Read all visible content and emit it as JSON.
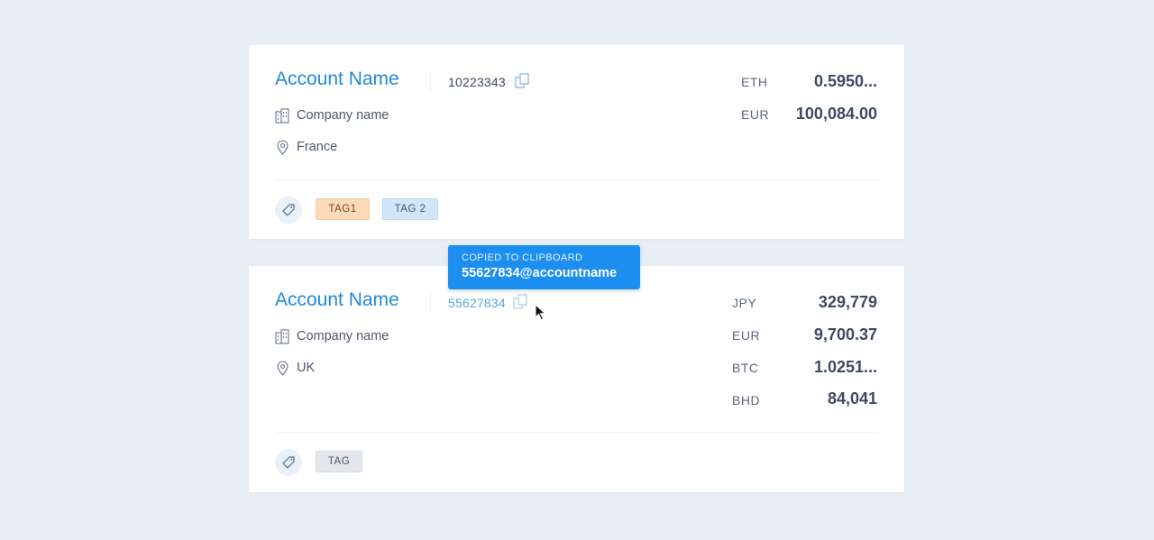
{
  "accounts": [
    {
      "name": "Account Name",
      "id": "10223343",
      "company": "Company name",
      "location": "France",
      "balances": [
        {
          "currency": "ETH",
          "amount": "0.5950..."
        },
        {
          "currency": "EUR",
          "amount": "100,084.00"
        }
      ],
      "tags": [
        "TAG1",
        "TAG 2"
      ]
    },
    {
      "name": "Account Name",
      "id": "55627834",
      "company": "Company name",
      "location": "UK",
      "balances": [
        {
          "currency": "JPY",
          "amount": "329,779"
        },
        {
          "currency": "EUR",
          "amount": "9,700.37"
        },
        {
          "currency": "BTC",
          "amount": "1.0251..."
        },
        {
          "currency": "BHD",
          "amount": "84,041"
        }
      ],
      "tags": [
        "TAG"
      ]
    }
  ],
  "tooltip": {
    "title": "COPIED TO CLIPBOARD",
    "value": "55627834@accountname"
  },
  "icons": {
    "copy": "copy-icon",
    "company": "building-icon",
    "location": "location-pin-icon",
    "tag": "tag-icon",
    "cursor": "mouse-pointer-icon"
  },
  "colors": {
    "background": "#e8eef5",
    "accent": "#1f8ad6",
    "tooltip": "#1b8ef0",
    "tag_orange": "#fdd9b5",
    "tag_blue": "#d2e6f8",
    "tag_grey": "#e4e7ec"
  }
}
